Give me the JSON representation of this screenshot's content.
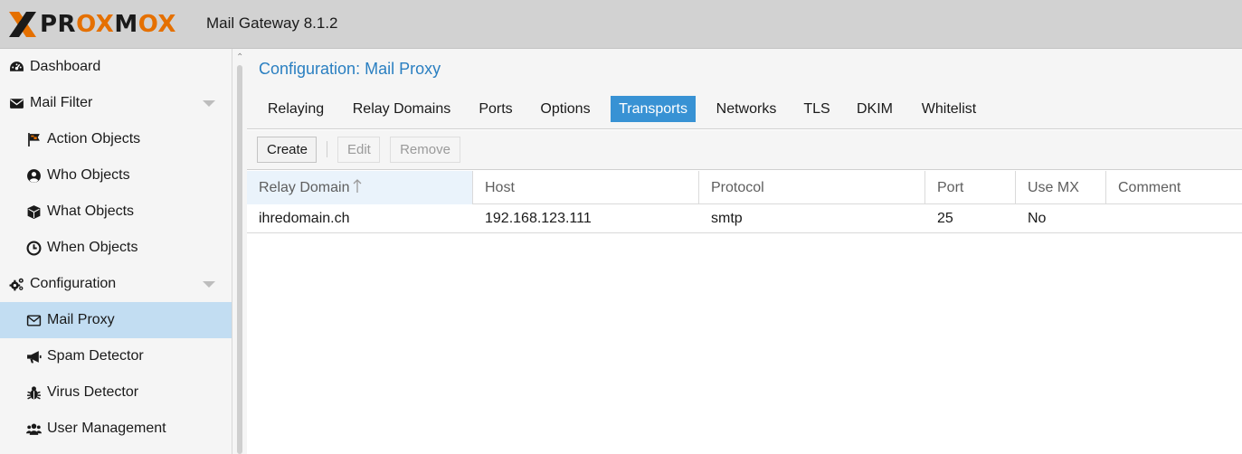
{
  "header": {
    "logo_text_a": "PR",
    "logo_text_b": "OX",
    "logo_text_c": "M",
    "logo_text_d": "OX",
    "version": "Mail Gateway 8.1.2"
  },
  "sidebar": {
    "items": [
      {
        "label": "Dashboard",
        "icon": "dashboard-icon"
      },
      {
        "label": "Mail Filter",
        "icon": "envelope-icon"
      },
      {
        "label": "Action Objects",
        "icon": "flag-icon"
      },
      {
        "label": "Who Objects",
        "icon": "user-circle-icon"
      },
      {
        "label": "What Objects",
        "icon": "cube-icon"
      },
      {
        "label": "When Objects",
        "icon": "clock-icon"
      },
      {
        "label": "Configuration",
        "icon": "gears-icon"
      },
      {
        "label": "Mail Proxy",
        "icon": "envelope-outline-icon"
      },
      {
        "label": "Spam Detector",
        "icon": "bullhorn-icon"
      },
      {
        "label": "Virus Detector",
        "icon": "bug-icon"
      },
      {
        "label": "User Management",
        "icon": "users-icon"
      }
    ]
  },
  "main": {
    "title": "Configuration: Mail Proxy",
    "tabs": [
      "Relaying",
      "Relay Domains",
      "Ports",
      "Options",
      "Transports",
      "Networks",
      "TLS",
      "DKIM",
      "Whitelist"
    ],
    "active_tab": "Transports",
    "toolbar": {
      "create": "Create",
      "edit": "Edit",
      "remove": "Remove"
    },
    "grid": {
      "columns": [
        "Relay Domain",
        "Host",
        "Protocol",
        "Port",
        "Use MX",
        "Comment"
      ],
      "rows": [
        [
          "ihredomain.ch",
          "192.168.123.111",
          "smtp",
          "25",
          "No",
          ""
        ]
      ]
    }
  },
  "colors": {
    "accent": "#3892d4",
    "brand_orange": "#e57000",
    "title_blue": "#2a7fc1",
    "active_nav": "#c2ddf2"
  }
}
